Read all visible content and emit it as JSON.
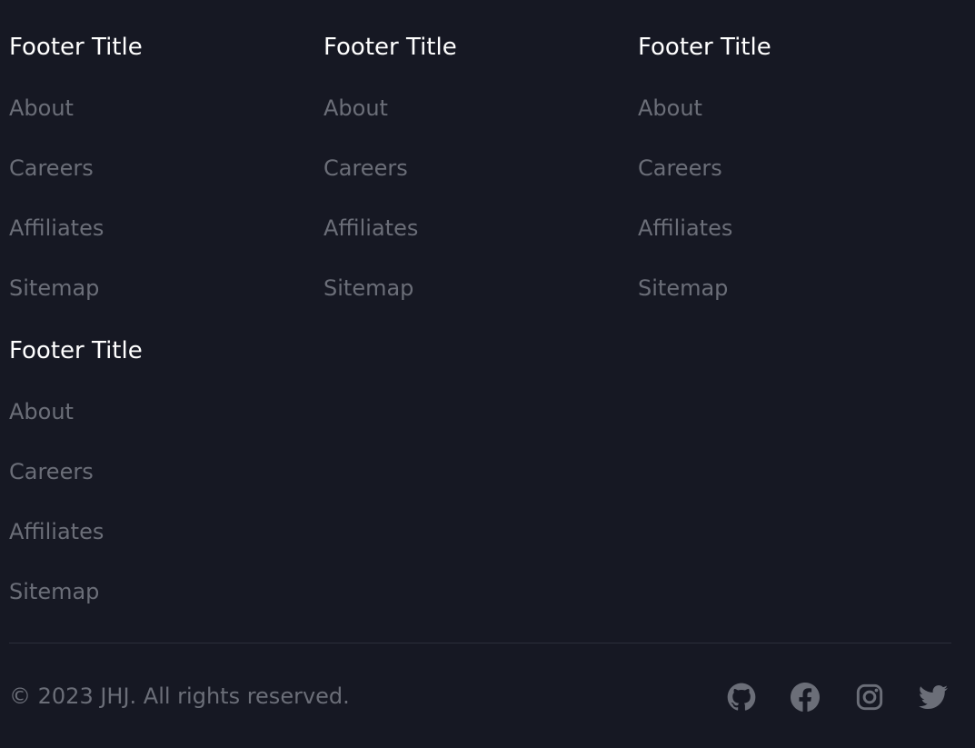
{
  "footer": {
    "columns": [
      {
        "title": "Footer Title",
        "links": [
          "About",
          "Careers",
          "Affiliates",
          "Sitemap"
        ]
      },
      {
        "title": "Footer Title",
        "links": [
          "About",
          "Careers",
          "Affiliates",
          "Sitemap"
        ]
      },
      {
        "title": "Footer Title",
        "links": [
          "About",
          "Careers",
          "Affiliates",
          "Sitemap"
        ]
      },
      {
        "title": "Footer Title",
        "links": [
          "About",
          "Careers",
          "Affiliates",
          "Sitemap"
        ]
      }
    ],
    "copyright": "© 2023 JHJ. All rights reserved.",
    "social_icons": [
      "github-icon",
      "facebook-icon",
      "instagram-icon",
      "twitter-icon"
    ],
    "colors": {
      "background": "#161823",
      "title": "#ffffff",
      "link": "#6b6e78",
      "divider": "#2b2e3a"
    }
  }
}
